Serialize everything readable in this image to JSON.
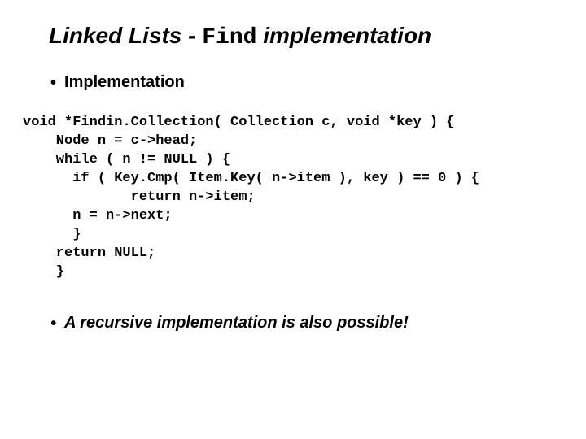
{
  "title": {
    "prefix": "Linked Lists - ",
    "code": "Find",
    "suffix": " implementation"
  },
  "bullet1": {
    "dot": "•",
    "text": "Implementation"
  },
  "code": {
    "line1": "void *Findin.Collection( Collection c, void *key ) {",
    "line2": "    Node n = c->head;",
    "line3": "    while ( n != NULL ) {",
    "line4": "      if ( Key.Cmp( Item.Key( n->item ), key ) == 0 ) {",
    "line5": "             return n->item;",
    "line6": "      n = n->next;",
    "line7": "      }",
    "line8": "    return NULL;",
    "line9": "    }"
  },
  "bullet2": {
    "dot": "•",
    "text": "A recursive implementation is also possible!"
  }
}
